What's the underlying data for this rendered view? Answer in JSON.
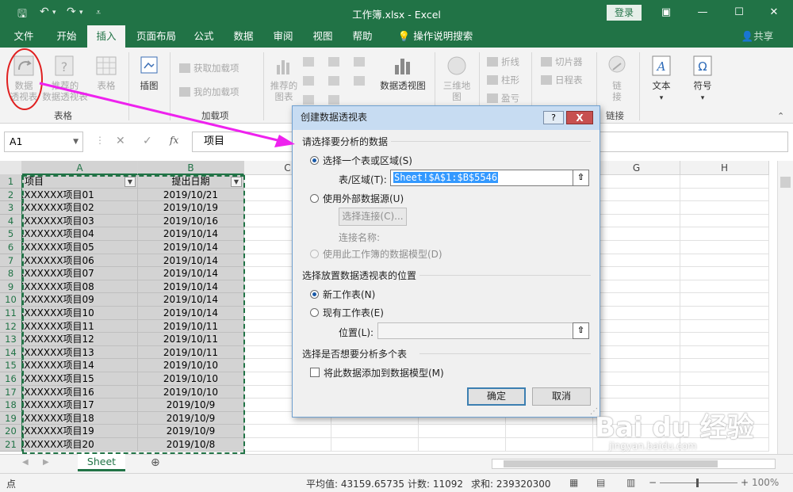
{
  "window": {
    "title": "工作簿.xlsx  -  Excel",
    "login_label": "登录",
    "share_label": "共享"
  },
  "tabs": [
    "文件",
    "开始",
    "插入",
    "页面布局",
    "公式",
    "数据",
    "审阅",
    "视图",
    "帮助"
  ],
  "active_tab": "插入",
  "tell_me": "操作说明搜索",
  "ribbon": {
    "pivot": "数据\n透视表",
    "rec_pivot": "推荐的\n数据透视表",
    "table": "表格",
    "illustrations": "插图",
    "get_addins": "获取加载项",
    "my_addins": "我的加载项",
    "rec_charts": "推荐的\n图表",
    "pivot_chart": "数据透视图",
    "map3d": "三维地\n图",
    "line": "折线",
    "column": "柱形",
    "winloss": "盈亏",
    "slicer": "切片器",
    "timeline": "日程表",
    "link": "链\n接",
    "text": "文本",
    "symbol": "符号",
    "group_tables": "表格",
    "group_addins": "加载项",
    "group_links": "链接"
  },
  "formula_bar": {
    "name_box": "A1",
    "fx_label": "fx",
    "content": "项目"
  },
  "columns": [
    "A",
    "B",
    "C",
    "D",
    "E",
    "F",
    "G",
    "H"
  ],
  "headers": [
    "项目",
    "提出日期"
  ],
  "rows": [
    [
      "XXXXXXX项目01",
      "2019/10/21"
    ],
    [
      "XXXXXXX项目02",
      "2019/10/19"
    ],
    [
      "XXXXXXX项目03",
      "2019/10/16"
    ],
    [
      "XXXXXXX项目04",
      "2019/10/14"
    ],
    [
      "XXXXXXX项目05",
      "2019/10/14"
    ],
    [
      "XXXXXXX项目06",
      "2019/10/14"
    ],
    [
      "XXXXXXX项目07",
      "2019/10/14"
    ],
    [
      "XXXXXXX项目08",
      "2019/10/14"
    ],
    [
      "XXXXXXX项目09",
      "2019/10/14"
    ],
    [
      "XXXXXXX项目10",
      "2019/10/14"
    ],
    [
      "XXXXXXX项目11",
      "2019/10/11"
    ],
    [
      "XXXXXXX项目12",
      "2019/10/11"
    ],
    [
      "XXXXXXX项目13",
      "2019/10/11"
    ],
    [
      "XXXXXXX项目14",
      "2019/10/10"
    ],
    [
      "XXXXXXX项目15",
      "2019/10/10"
    ],
    [
      "XXXXXXX项目16",
      "2019/10/10"
    ],
    [
      "XXXXXXX项目17",
      "2019/10/9"
    ],
    [
      "XXXXXXX项目18",
      "2019/10/9"
    ],
    [
      "XXXXXXX项目19",
      "2019/10/9"
    ],
    [
      "XXXXXXX项目20",
      "2019/10/8"
    ]
  ],
  "dialog": {
    "title": "创建数据透视表",
    "help": "?",
    "close": "X",
    "section1": "请选择要分析的数据",
    "opt_range": "选择一个表或区域(S)",
    "range_label": "表/区域(T):",
    "range_value": "Sheet!$A$1:$B$5546",
    "opt_external": "使用外部数据源(U)",
    "choose_conn": "选择连接(C)...",
    "conn_name": "连接名称:",
    "opt_model": "使用此工作簿的数据模型(D)",
    "section2": "选择放置数据透视表的位置",
    "opt_new": "新工作表(N)",
    "opt_existing": "现有工作表(E)",
    "location_label": "位置(L):",
    "location_value": "",
    "section3": "选择是否想要分析多个表",
    "add_model": "将此数据添加到数据模型(M)",
    "ok": "确定",
    "cancel": "取消"
  },
  "sheet": {
    "name": "Sheet"
  },
  "status": {
    "mode": "点",
    "average": "平均值: 43159.65735",
    "count": "计数: 11092",
    "sum": "求和: 239320300",
    "zoom": "100%"
  },
  "watermark": {
    "text": "Bai du 经验",
    "sub": "jingyan.baidu.com"
  },
  "colors": {
    "excel_green": "#217346",
    "annotation": "#ee22ee",
    "circle": "#e02020"
  }
}
